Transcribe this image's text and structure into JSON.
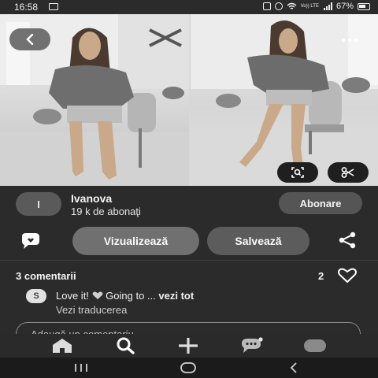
{
  "status_bar": {
    "time": "16:58",
    "volte": "Vo)) LTE",
    "battery_percent": "67%"
  },
  "pin": {
    "creator_initial": "I",
    "creator_name": "Ivanova",
    "followers": "19 k de abonaţi",
    "follow_label": "Abonare",
    "visualize_label": "Vizualizează",
    "save_label": "Salvează"
  },
  "comments": {
    "title": "3 comentarii",
    "reaction_count": "2",
    "first": {
      "author_initial": "S",
      "text": "Love it!",
      "text_after_emoji": "Going to ...",
      "see_all": "vezi tot"
    },
    "translate_label": "Vezi traducerea",
    "input_placeholder": "Adaugă un comentariu"
  },
  "icons": {
    "back": "chevron-left-icon",
    "more": "more-dots-icon",
    "lens": "visual-search-icon",
    "scissors": "scissors-icon",
    "comment": "comment-bubble-icon",
    "share": "share-icon",
    "heart": "heart-outline-icon",
    "nav": [
      "home-icon",
      "search-icon",
      "plus-icon",
      "messages-icon",
      "profile-icon"
    ],
    "system": [
      "recents-icon",
      "home-circle-icon",
      "back-triangle-icon"
    ]
  },
  "colors": {
    "background": "#2b2b2b",
    "primary_button": "#707070",
    "secondary_button": "#5c5c5c",
    "text": "#f2f2f2"
  }
}
